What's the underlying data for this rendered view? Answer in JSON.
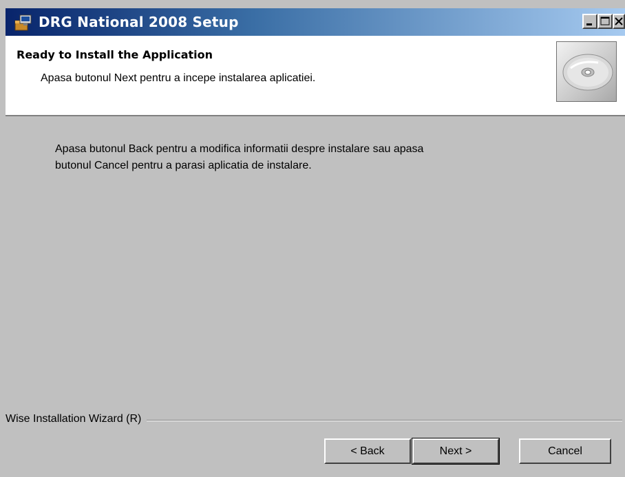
{
  "window": {
    "title": "DRG National 2008 Setup",
    "title_icon": "setup-package-icon",
    "controls": [
      "minimize-icon",
      "maximize-icon",
      "close-icon"
    ]
  },
  "header": {
    "title": "Ready to Install the Application",
    "subtitle": "Apasa butonul Next pentru a incepe instalarea aplicatiei.",
    "graphic": "cd-disc-icon"
  },
  "body": {
    "lines": [
      "Apasa butonul Back pentru a modifica informatii despre instalare sau apasa",
      "butonul Cancel pentru a parasi aplicatia de instalare."
    ]
  },
  "footer": {
    "brand": "Wise Installation Wizard (R)",
    "back_label": "< Back",
    "next_label": "Next >",
    "cancel_label": "Cancel"
  },
  "colors": {
    "titlebar_start": "#08246b",
    "titlebar_end": "#a6caf0",
    "dialog_bg": "#c0c0c0",
    "header_bg": "#ffffff"
  }
}
